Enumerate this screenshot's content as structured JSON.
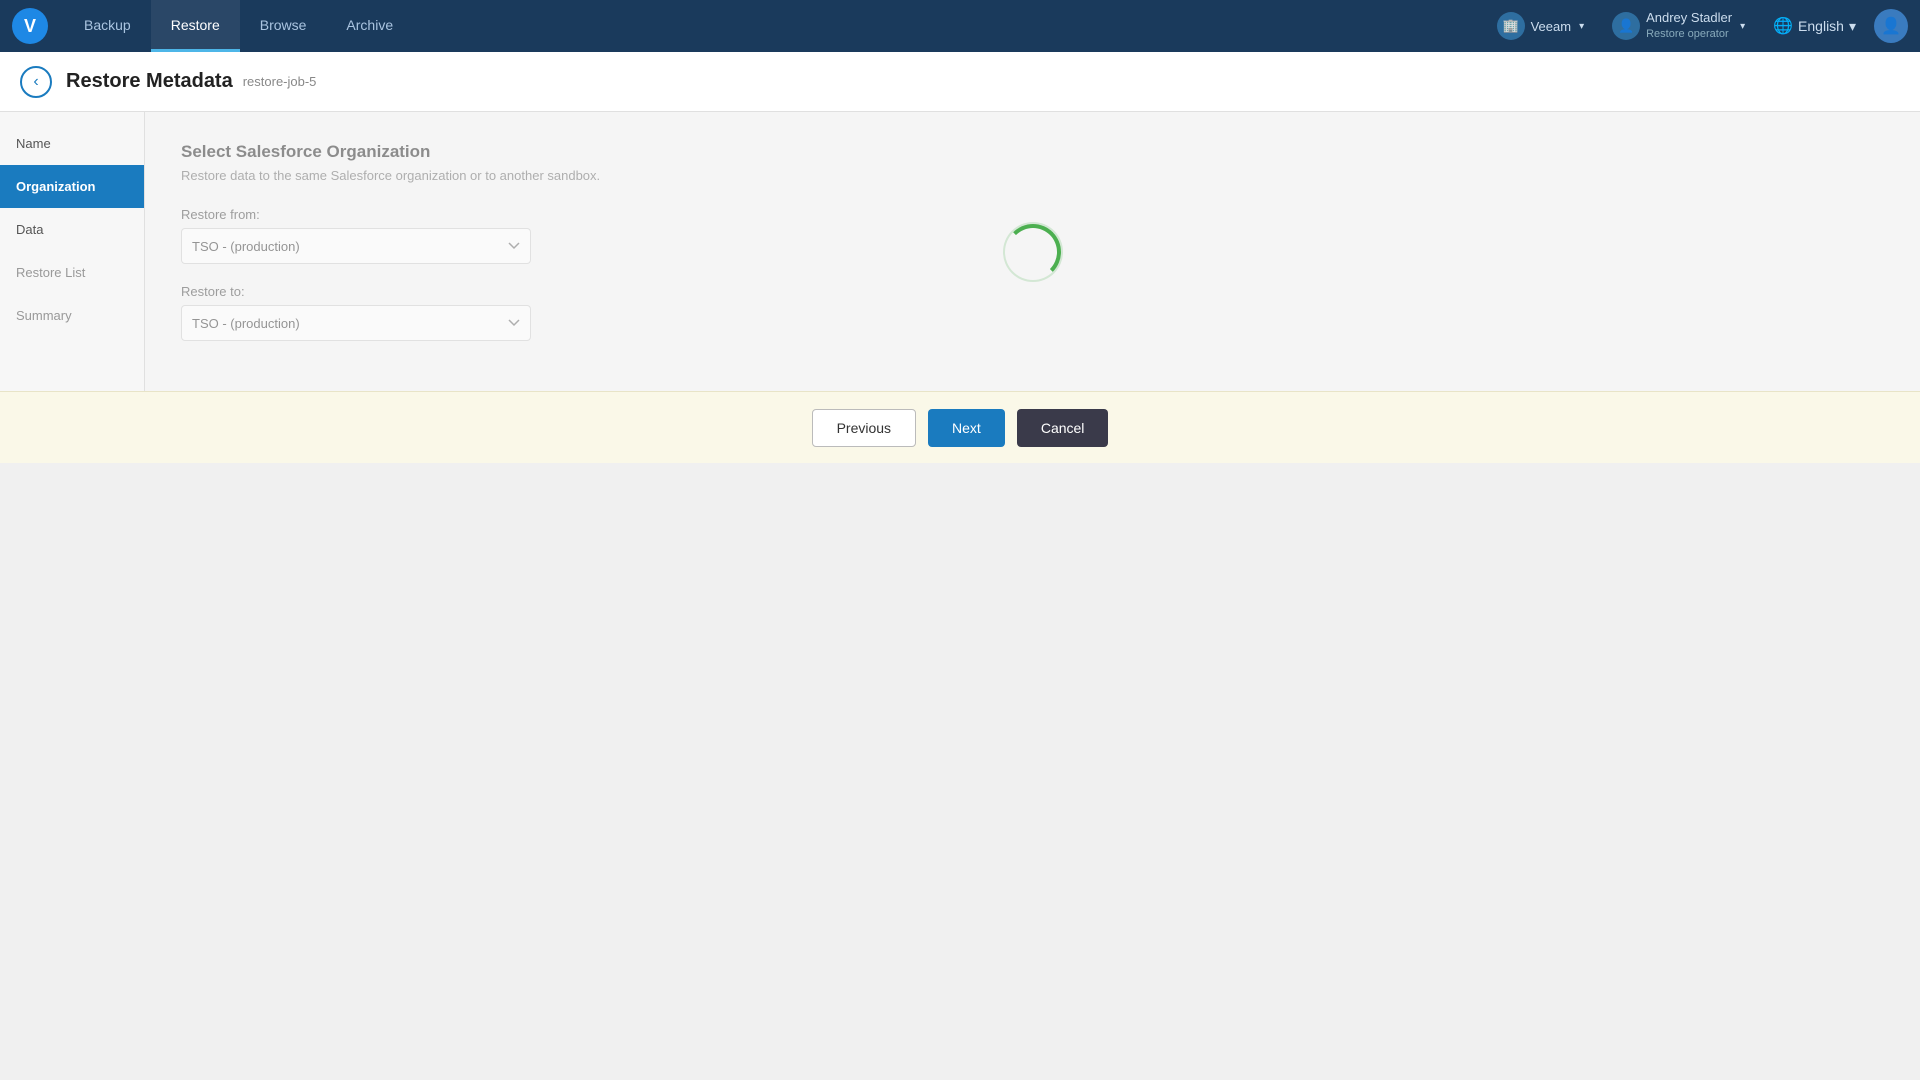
{
  "app": {
    "logo_text": "V",
    "logo_bg": "#1e88e5"
  },
  "topnav": {
    "tabs": [
      {
        "id": "backup",
        "label": "Backup",
        "active": false
      },
      {
        "id": "restore",
        "label": "Restore",
        "active": true
      },
      {
        "id": "browse",
        "label": "Browse",
        "active": false
      },
      {
        "id": "archive",
        "label": "Archive",
        "active": false
      }
    ],
    "veeam": {
      "icon": "🏢",
      "label": "Veeam",
      "chevron": "▾"
    },
    "user": {
      "label": "Andrey Stadler",
      "sublabel": "Restore operator",
      "chevron": "▾"
    },
    "language": {
      "label": "English",
      "chevron": "▾"
    },
    "user_icon": "👤"
  },
  "page": {
    "title": "Restore Metadata",
    "subtitle": "restore-job-5",
    "back_label": "‹"
  },
  "sidebar": {
    "items": [
      {
        "id": "name",
        "label": "Name",
        "active": false,
        "muted": false
      },
      {
        "id": "organization",
        "label": "Organization",
        "active": true,
        "muted": false
      },
      {
        "id": "data",
        "label": "Data",
        "active": false,
        "muted": false
      },
      {
        "id": "restore-list",
        "label": "Restore List",
        "active": false,
        "muted": true
      },
      {
        "id": "summary",
        "label": "Summary",
        "active": false,
        "muted": true
      }
    ]
  },
  "main": {
    "section_title": "Select Salesforce Organization",
    "section_desc": "Restore data to the same Salesforce organization or to another sandbox.",
    "restore_from_label": "Restore from:",
    "restore_from_value": "TSO - (production)",
    "restore_to_label": "Restore to:",
    "restore_to_value": "TSO - (production)",
    "restore_from_options": [
      "TSO - (production)"
    ],
    "restore_to_options": [
      "TSO - (production)"
    ]
  },
  "footer": {
    "previous_label": "Previous",
    "next_label": "Next",
    "cancel_label": "Cancel"
  }
}
